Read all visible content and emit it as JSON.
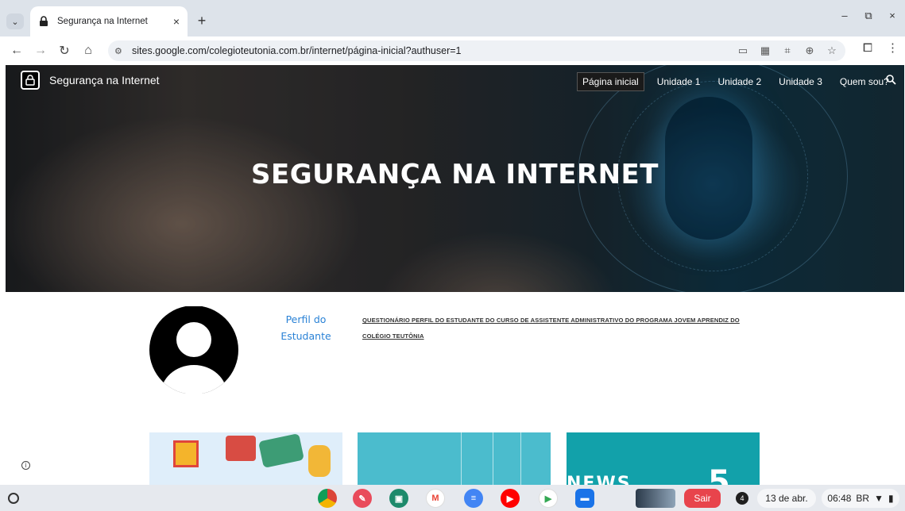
{
  "browser": {
    "tab_title": "Segurança na Internet",
    "tab_close": "×",
    "new_tab": "+",
    "window_controls": [
      "–",
      "⧉",
      "×"
    ],
    "url": "sites.google.com/colegioteutonia.com.br/internet/página-inicial?authuser=1"
  },
  "site": {
    "name": "Segurança na Internet",
    "nav": [
      {
        "label": "Página inicial",
        "active": true
      },
      {
        "label": "Unidade 1"
      },
      {
        "label": "Unidade 2"
      },
      {
        "label": "Unidade 3"
      },
      {
        "label": "Quem sou?"
      }
    ],
    "hero_title": "SEGURANÇA NA INTERNET"
  },
  "content": {
    "profile_link": "Perfil do Estudante",
    "questionnaire_link": "QUESTIONÁRIO PERFIL DO ESTUDANTE DO CURSO DE ASSISTENTE ADMINISTRATIVO DO PROGRAMA JOVEM APRENDIZ DO COLÉGIO TEUTÔNIA ",
    "card3_text": "NEWS",
    "card3_number": "5"
  },
  "shelf": {
    "exit_label": "Sair",
    "notification_count": "4",
    "date": "13 de abr.",
    "time": "06:48",
    "locale": "BR"
  },
  "colors": {
    "tabstrip": "#dde3ea",
    "link_blue": "#2a82d6",
    "exit_red": "#e8444c"
  }
}
